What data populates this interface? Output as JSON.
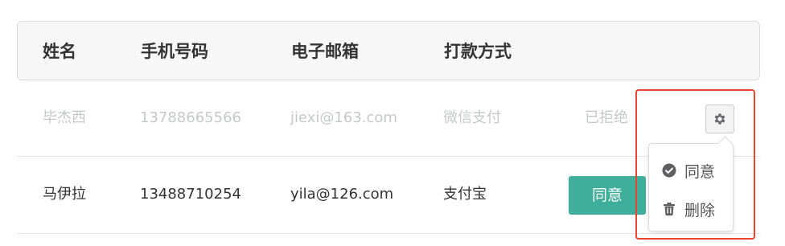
{
  "table": {
    "headers": [
      "姓名",
      "手机号码",
      "电子邮箱",
      "打款方式"
    ],
    "rows": [
      {
        "name": "毕杰西",
        "phone": "13788665566",
        "email": "jiexi@163.com",
        "payment": "微信支付",
        "status": "已拒绝"
      },
      {
        "name": "马伊拉",
        "phone": "13488710254",
        "email": "yila@126.com",
        "payment": "支付宝",
        "action_label": "同意"
      }
    ]
  },
  "dropdown": {
    "items": [
      {
        "label": "同意",
        "icon": "check-circle-icon"
      },
      {
        "label": "删除",
        "icon": "trash-icon"
      }
    ]
  },
  "colors": {
    "accent": "#3fae9b",
    "highlight": "#e8462f",
    "muted_text": "#c6c8cb"
  }
}
